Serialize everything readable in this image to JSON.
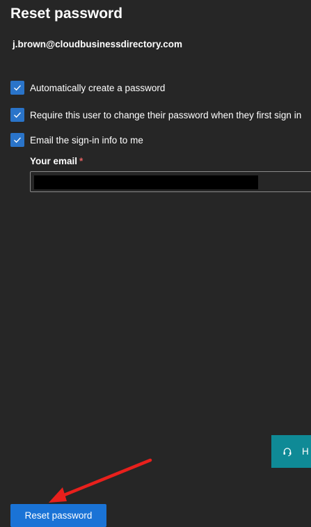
{
  "panel": {
    "title": "Reset password",
    "user_email": "j.brown@cloudbusinessdirectory.com"
  },
  "options": [
    {
      "label": "Automatically create a password",
      "checked": true
    },
    {
      "label": "Require this user to change their password when they first sign in",
      "checked": true
    },
    {
      "label": "Email the sign-in info to me",
      "checked": true
    }
  ],
  "your_email": {
    "label": "Your email",
    "required_marker": "*",
    "value_redacted": true
  },
  "help_tab": {
    "icon": "headset-icon",
    "label": "H"
  },
  "actions": {
    "reset_label": "Reset password"
  },
  "colors": {
    "background": "#262626",
    "checkbox": "#2a74c9",
    "primary_button": "#1a73d6",
    "help_tab": "#0f8a96",
    "annotation_arrow": "#e8201c"
  },
  "annotation": {
    "type": "arrow",
    "points_to": "reset-password-button"
  }
}
